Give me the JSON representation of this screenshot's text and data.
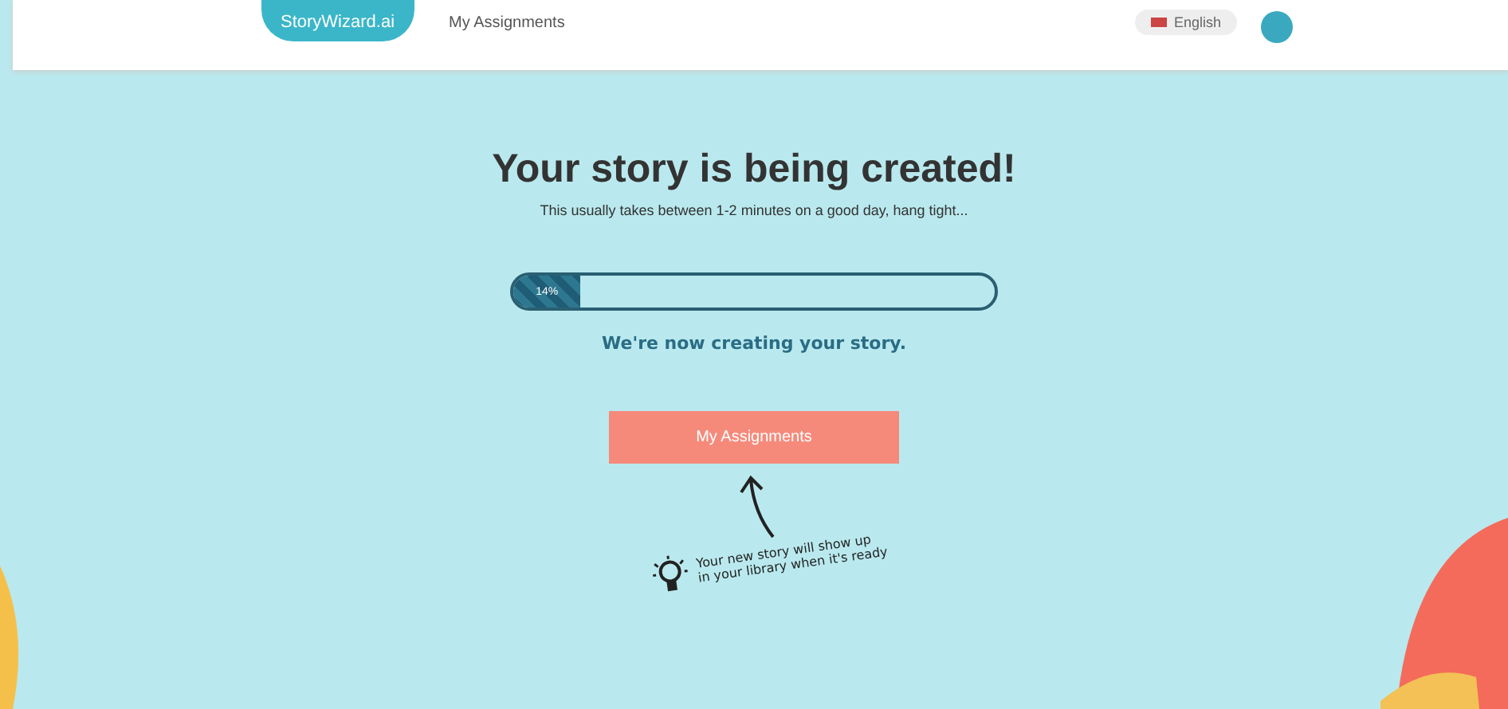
{
  "header": {
    "logo": "StoryWizard.ai",
    "nav_link": "My Assignments",
    "language": "English"
  },
  "main": {
    "title": "Your story is being created!",
    "subtitle": "This usually takes between 1-2 minutes on a good day, hang tight...",
    "progress": {
      "level": 0.14,
      "reading": "14%"
    },
    "status": "We're now creating your story.",
    "button": "My Assignments",
    "hint": "Your new story will show up in your library when it's ready"
  }
}
